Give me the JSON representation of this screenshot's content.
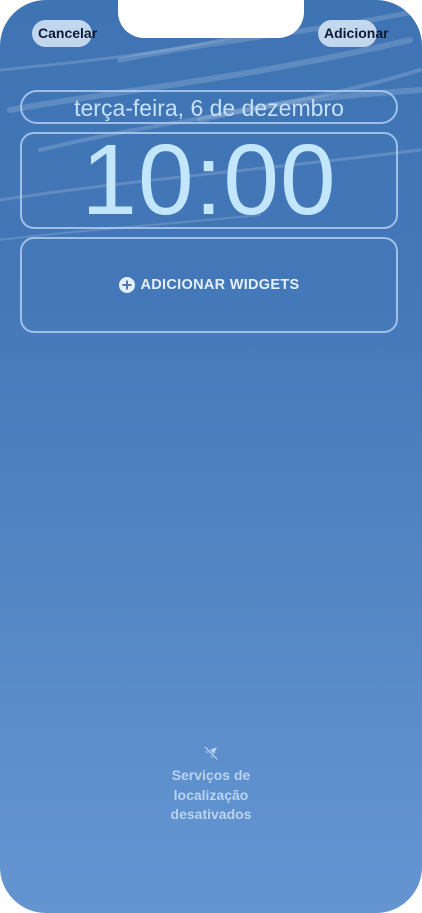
{
  "top_bar": {
    "cancel_label": "Cancelar",
    "add_label": "Adicionar"
  },
  "lock_screen": {
    "date": "terça-feira, 6 de dezembro",
    "time": "10:00",
    "add_widgets_label": "ADICIONAR WIDGETS"
  },
  "location_status": {
    "icon": "location-slash-icon",
    "text": "Serviços de\nlocalização\ndesativados"
  },
  "colors": {
    "background_top": "#3f74b3",
    "background_bottom": "#6595d1",
    "frame_border": "#afcdf0",
    "clock_text": "#c2e6fc",
    "button_bg": "#cddef2"
  }
}
